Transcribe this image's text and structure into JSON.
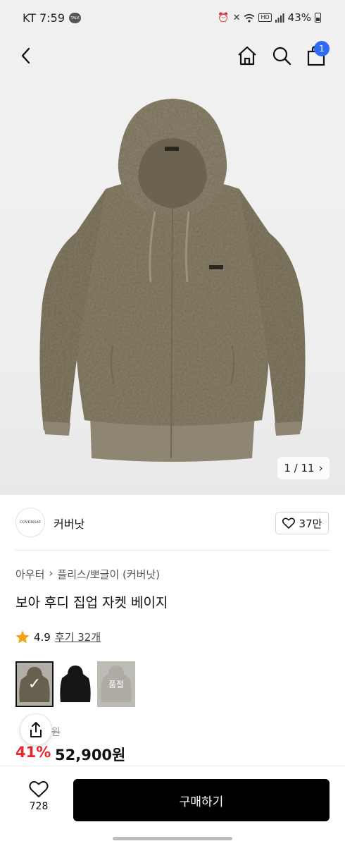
{
  "status_bar": {
    "carrier_time": "KT 7:59",
    "talk_badge": "TALK",
    "hd_badge": "HD",
    "battery": "43%"
  },
  "nav": {
    "back_icon": "chevron-left-icon",
    "home_icon": "home-icon",
    "search_icon": "search-icon",
    "cart_icon": "shopping-bag-icon",
    "cart_count": "1"
  },
  "gallery": {
    "pager": "1 / 11",
    "pager_arrow": "›",
    "product_color_hex": "#8a8169"
  },
  "brand": {
    "logo_text": "COVERNAT",
    "name": "커버낫",
    "like_count": "37만"
  },
  "breadcrumb": {
    "category": "아우터",
    "separator": "›",
    "subcategory": "플리스/뽀글이 (커버낫)"
  },
  "product": {
    "title": "보아 후디 집업 자켓 베이지",
    "rating": "4.9",
    "review_label": "후기 32개",
    "swatches": [
      {
        "color": "#8a8169",
        "selected": true
      },
      {
        "color": "#151515"
      },
      {
        "color": "#c8c3bb",
        "sold_out_label": "품절"
      }
    ],
    "original_price": "9원",
    "discount": "41%",
    "price": "52,900원"
  },
  "bottom": {
    "wish_count": "728",
    "buy_label": "구매하기"
  }
}
